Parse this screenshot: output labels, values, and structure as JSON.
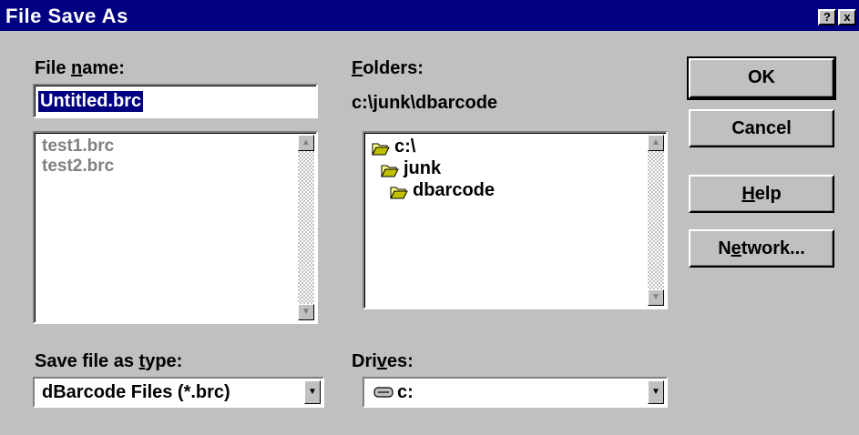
{
  "window": {
    "title": "File Save As",
    "help_button": "?",
    "close_button": "x"
  },
  "filename": {
    "label_prefix": "File ",
    "label_accel": "n",
    "label_suffix": "ame:",
    "value": "Untitled.brc",
    "files": [
      "test1.brc",
      "test2.brc"
    ]
  },
  "folders": {
    "label_accel": "F",
    "label_suffix": "olders:",
    "current_path": "c:\\junk\\dbarcode",
    "tree": [
      {
        "name": "c:\\",
        "icon": "open-folder-icon"
      },
      {
        "name": "junk",
        "icon": "open-folder-icon"
      },
      {
        "name": "dbarcode",
        "icon": "open-folder-icon"
      }
    ]
  },
  "buttons": {
    "ok": "OK",
    "cancel": "Cancel",
    "help_accel": "H",
    "help_suffix": "elp",
    "network_prefix": "N",
    "network_accel": "e",
    "network_suffix": "twork..."
  },
  "save_type": {
    "label_prefix": "Save file as ",
    "label_accel": "t",
    "label_suffix": "ype:",
    "value": "dBarcode Files (*.brc)"
  },
  "drives": {
    "label_prefix": "Dri",
    "label_accel": "v",
    "label_suffix": "es:",
    "value": "c:",
    "icon": "drive-icon"
  },
  "colors": {
    "titlebar": "#000080",
    "face": "#c0c0c0",
    "selection": "#000080"
  }
}
